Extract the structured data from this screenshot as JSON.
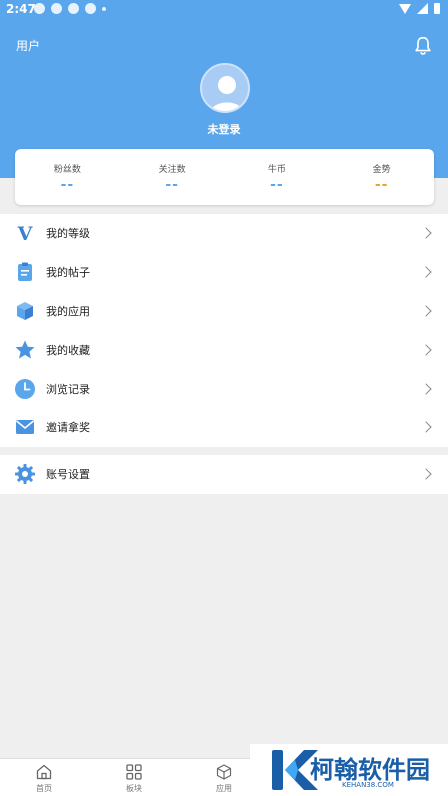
{
  "status_bar": {
    "time": "2:47"
  },
  "header": {
    "title": "用户",
    "login_status": "未登录"
  },
  "stats": [
    {
      "label": "粉丝数",
      "value": "--"
    },
    {
      "label": "关注数",
      "value": "--"
    },
    {
      "label": "牛币",
      "value": "--"
    },
    {
      "label": "金势",
      "value": "--"
    }
  ],
  "menu": [
    {
      "label": "我的等级",
      "icon": "v-level-icon"
    },
    {
      "label": "我的帖子",
      "icon": "clipboard-icon"
    },
    {
      "label": "我的应用",
      "icon": "box-icon"
    },
    {
      "label": "我的收藏",
      "icon": "star-icon"
    },
    {
      "label": "浏览记录",
      "icon": "clock-icon"
    },
    {
      "label": "邀请拿奖",
      "icon": "mail-icon"
    }
  ],
  "settings": {
    "label": "账号设置",
    "icon": "gear-icon"
  },
  "bottom_nav": [
    {
      "label": "首页",
      "icon": "home-icon"
    },
    {
      "label": "板块",
      "icon": "grid-icon"
    },
    {
      "label": "应用",
      "icon": "cube-icon"
    }
  ],
  "watermark": {
    "title": "柯翰软件园",
    "subtitle": "KEHAN38.COM"
  },
  "colors": {
    "primary": "#5aa6ec",
    "gold": "#f0a12e",
    "background": "#efefef"
  }
}
